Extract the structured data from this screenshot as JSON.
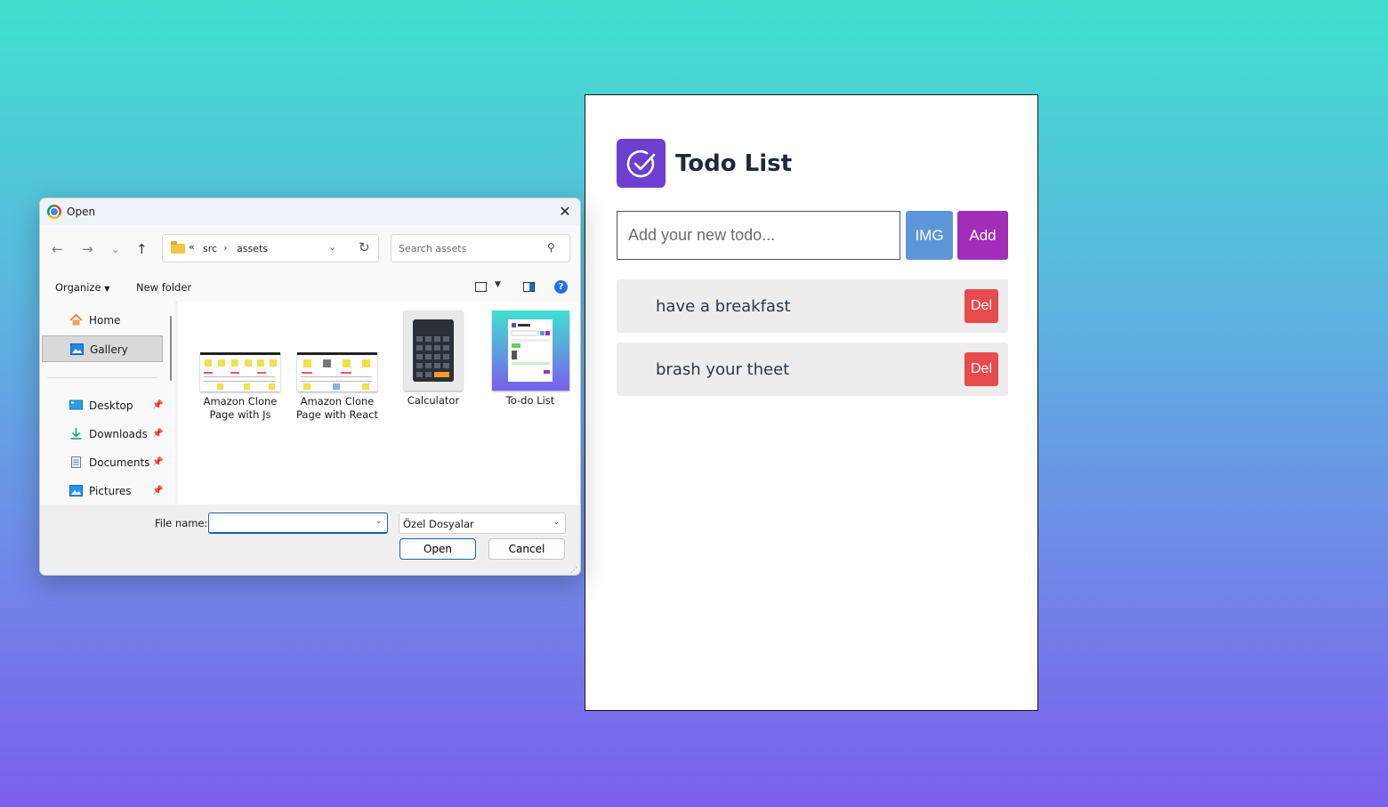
{
  "todo": {
    "title": "Todo List",
    "input_placeholder": "Add your new todo...",
    "img_label": "IMG",
    "add_label": "Add",
    "items": [
      {
        "text": "have a breakfast",
        "del_label": "Del"
      },
      {
        "text": "brash your theet",
        "del_label": "Del"
      }
    ],
    "colors": {
      "logo": "#6c3fd1",
      "img_button": "#5d97d8",
      "add_button": "#a22db8",
      "del_button": "#e84b4b"
    }
  },
  "dialog": {
    "title": "Open",
    "close_glyph": "✕",
    "breadcrumb": {
      "overflow": "«",
      "segments": [
        "src",
        "assets"
      ]
    },
    "search_placeholder": "Search assets",
    "toolbar": {
      "organize": "Organize",
      "new_folder": "New folder"
    },
    "sidebar": [
      {
        "label": "Home",
        "icon": "home-icon"
      },
      {
        "label": "Gallery",
        "icon": "gallery-icon",
        "selected": true
      },
      {
        "label": "Desktop",
        "icon": "desktop-icon",
        "pinned": true
      },
      {
        "label": "Downloads",
        "icon": "download-icon",
        "pinned": true
      },
      {
        "label": "Documents",
        "icon": "documents-icon",
        "pinned": true
      },
      {
        "label": "Pictures",
        "icon": "pictures-icon",
        "pinned": true
      }
    ],
    "files": [
      {
        "name": "Amazon Clone Page with Js"
      },
      {
        "name": "Amazon Clone Page with React"
      },
      {
        "name": "Calculator"
      },
      {
        "name": "To-do List"
      }
    ],
    "file_name_label": "File name:",
    "file_name_value": "",
    "filter_value": "Özel Dosyalar",
    "open_label": "Open",
    "cancel_label": "Cancel"
  }
}
